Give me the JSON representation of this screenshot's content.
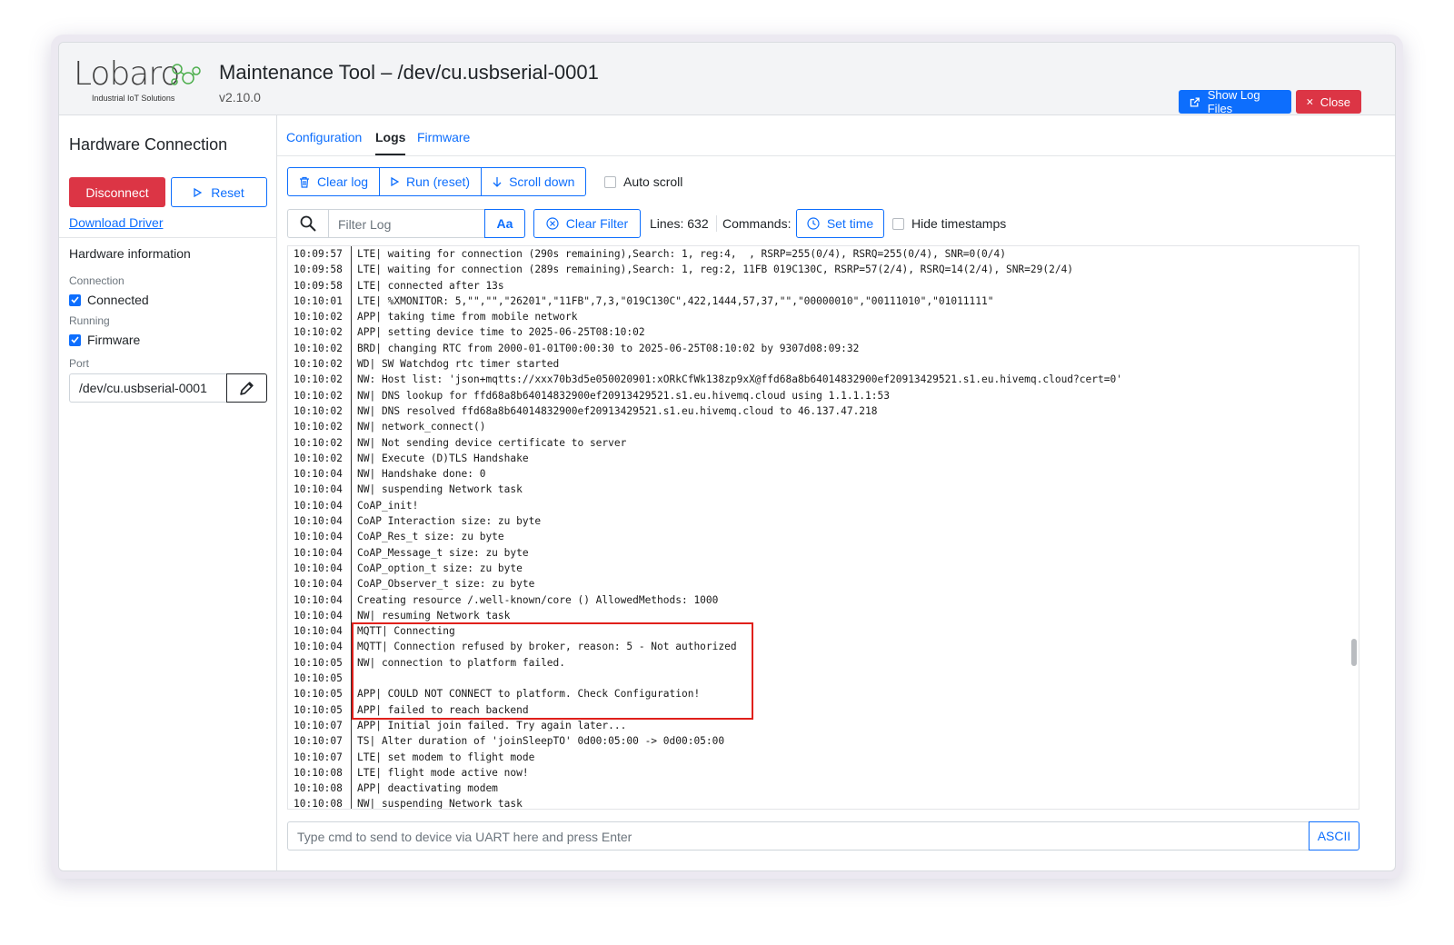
{
  "header": {
    "logo_word": "Lobaro",
    "logo_tagline": "Industrial IoT Solutions",
    "title": "Maintenance Tool – /dev/cu.usbserial-0001",
    "version": "v2.10.0",
    "show_log_files": "Show Log Files",
    "close": "Close",
    "colors": {
      "primary": "#0d6efd",
      "danger": "#dc3545",
      "logo_green": "#4cae4c"
    }
  },
  "sidebar": {
    "title": "Hardware Connection",
    "disconnect": "Disconnect",
    "reset": "Reset",
    "download_driver": "Download Driver",
    "hw_info": "Hardware information",
    "connection_label": "Connection",
    "connected": "Connected",
    "running_label": "Running",
    "firmware": "Firmware",
    "port_label": "Port",
    "port_value": "/dev/cu.usbserial-0001"
  },
  "tabs": [
    {
      "label": "Configuration",
      "active": false
    },
    {
      "label": "Logs",
      "active": true
    },
    {
      "label": "Firmware",
      "active": false
    }
  ],
  "toolbar": {
    "clear_log": "Clear log",
    "run_reset": "Run (reset)",
    "scroll_down": "Scroll down",
    "auto_scroll": "Auto scroll",
    "filter_placeholder": "Filter Log",
    "case_toggle": "Aa",
    "clear_filter": "Clear Filter",
    "lines": "Lines: 632",
    "commands": "Commands:",
    "set_time": "Set time",
    "hide_timestamps": "Hide timestamps"
  },
  "log": [
    {
      "ts": "10:09:57",
      "msg": "LTE| waiting for connection (290s remaining),Search: 1, reg:4,  , RSRP=255(0/4), RSRQ=255(0/4), SNR=0(0/4)"
    },
    {
      "ts": "10:09:58",
      "msg": "LTE| waiting for connection (289s remaining),Search: 1, reg:2, 11FB 019C130C, RSRP=57(2/4), RSRQ=14(2/4), SNR=29(2/4)"
    },
    {
      "ts": "10:09:58",
      "msg": "LTE| connected after 13s"
    },
    {
      "ts": "10:10:01",
      "msg": "LTE| %XMONITOR: 5,\"\",\"\",\"26201\",\"11FB\",7,3,\"019C130C\",422,1444,57,37,\"\",\"00000010\",\"00111010\",\"01011111\""
    },
    {
      "ts": "10:10:02",
      "msg": "APP| taking time from mobile network"
    },
    {
      "ts": "10:10:02",
      "msg": "APP| setting device time to 2025-06-25T08:10:02"
    },
    {
      "ts": "10:10:02",
      "msg": "BRD| changing RTC from 2000-01-01T00:00:30 to 2025-06-25T08:10:02 by 9307d08:09:32"
    },
    {
      "ts": "10:10:02",
      "msg": "WD| SW Watchdog rtc timer started"
    },
    {
      "ts": "10:10:02",
      "msg": "NW: Host list: 'json+mqtts://xxx70b3d5e050020901:xORkCfWk138zp9xX@ffd68a8b64014832900ef20913429521.s1.eu.hivemq.cloud?cert=0'"
    },
    {
      "ts": "10:10:02",
      "msg": "NW| DNS lookup for ffd68a8b64014832900ef20913429521.s1.eu.hivemq.cloud using 1.1.1.1:53"
    },
    {
      "ts": "10:10:02",
      "msg": "NW| DNS resolved ffd68a8b64014832900ef20913429521.s1.eu.hivemq.cloud to 46.137.47.218"
    },
    {
      "ts": "10:10:02",
      "msg": "NW| network_connect()"
    },
    {
      "ts": "10:10:02",
      "msg": "NW| Not sending device certificate to server"
    },
    {
      "ts": "10:10:02",
      "msg": "NW| Execute (D)TLS Handshake"
    },
    {
      "ts": "10:10:04",
      "msg": "NW| Handshake done: 0"
    },
    {
      "ts": "10:10:04",
      "msg": "NW| suspending Network task"
    },
    {
      "ts": "10:10:04",
      "msg": "CoAP_init!"
    },
    {
      "ts": "10:10:04",
      "msg": "CoAP Interaction size: zu byte"
    },
    {
      "ts": "10:10:04",
      "msg": "CoAP_Res_t size: zu byte"
    },
    {
      "ts": "10:10:04",
      "msg": "CoAP_Message_t size: zu byte"
    },
    {
      "ts": "10:10:04",
      "msg": "CoAP_option_t size: zu byte"
    },
    {
      "ts": "10:10:04",
      "msg": "CoAP_Observer_t size: zu byte"
    },
    {
      "ts": "10:10:04",
      "msg": "Creating resource /.well-known/core () AllowedMethods: 1000"
    },
    {
      "ts": "10:10:04",
      "msg": "NW| resuming Network task"
    },
    {
      "ts": "10:10:04",
      "msg": "MQTT| Connecting"
    },
    {
      "ts": "10:10:04",
      "msg": "MQTT| Connection refused by broker, reason: 5 - Not authorized"
    },
    {
      "ts": "10:10:05",
      "msg": "NW| connection to platform failed."
    },
    {
      "ts": "10:10:05",
      "msg": ""
    },
    {
      "ts": "10:10:05",
      "msg": "APP| COULD NOT CONNECT to platform. Check Configuration!"
    },
    {
      "ts": "10:10:05",
      "msg": "APP| failed to reach backend"
    },
    {
      "ts": "10:10:07",
      "msg": "APP| Initial join failed. Try again later..."
    },
    {
      "ts": "10:10:07",
      "msg": "TS| Alter duration of 'joinSleepTO' 0d00:05:00 -> 0d00:05:00"
    },
    {
      "ts": "10:10:07",
      "msg": "LTE| set modem to flight mode"
    },
    {
      "ts": "10:10:08",
      "msg": "LTE| flight mode active now!"
    },
    {
      "ts": "10:10:08",
      "msg": "APP| deactivating modem"
    },
    {
      "ts": "10:10:08",
      "msg": "NW| suspending Network task"
    }
  ],
  "command": {
    "placeholder": "Type cmd to send to device via UART here and press Enter",
    "encoding": "ASCII"
  }
}
